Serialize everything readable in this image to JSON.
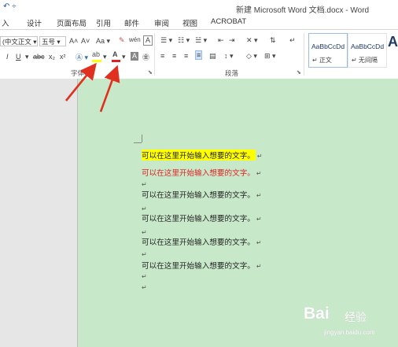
{
  "window": {
    "title": "新建 Microsoft Word 文档.docx - Word",
    "quick_access": "↶ ÷"
  },
  "tabs": [
    "入",
    "设计",
    "页面布局",
    "引用",
    "邮件",
    "审阅",
    "视图",
    "ACROBAT"
  ],
  "ribbon": {
    "font_name": "(中文正文",
    "font_size": "五号",
    "grow_font": "A˄",
    "shrink_font": "A˅",
    "change_case": "Aa",
    "phonetic": "wén",
    "char_border": "A",
    "italic": "I",
    "underline": "U",
    "strikethrough": "abc",
    "subscript": "x₂",
    "superscript": "x²",
    "highlight_color": "#ffff00",
    "font_color": "#e02020",
    "font_group_label": "字体",
    "paragraph_group_label": "段落",
    "styles": [
      {
        "sample": "AaBbCcDd",
        "name": "↵ 正文",
        "selected": true
      },
      {
        "sample": "AaBbCcDd",
        "name": "↵ 无间隔",
        "selected": false
      }
    ],
    "styles_more": "A"
  },
  "document": {
    "lines": [
      {
        "text": "可以在这里开始输入想要的文字。",
        "style": "highlight"
      },
      {
        "text": "可以在这里开始输入想要的文字。",
        "style": "red"
      },
      {
        "text": "",
        "style": "empty"
      },
      {
        "text": "可以在这里开始输入想要的文字。",
        "style": "normal"
      },
      {
        "text": "",
        "style": "empty"
      },
      {
        "text": "可以在这里开始输入想要的文字。",
        "style": "normal"
      },
      {
        "text": "",
        "style": "empty"
      },
      {
        "text": "可以在这里开始输入想要的文字。",
        "style": "normal"
      },
      {
        "text": "",
        "style": "empty"
      },
      {
        "text": "可以在这里开始输入想要的文字。",
        "style": "normal"
      },
      {
        "text": "",
        "style": "empty"
      },
      {
        "text": "",
        "style": "empty"
      }
    ],
    "paragraph_mark": "↵",
    "page_color": "#c8e8ca",
    "highlight_color": "#ffff00",
    "red_text_color": "#e02020"
  },
  "watermark": {
    "logo": "Bai",
    "logo_suffix": "经验",
    "url": "jingyan.baidu.com"
  },
  "annotation_color": "#e03020"
}
